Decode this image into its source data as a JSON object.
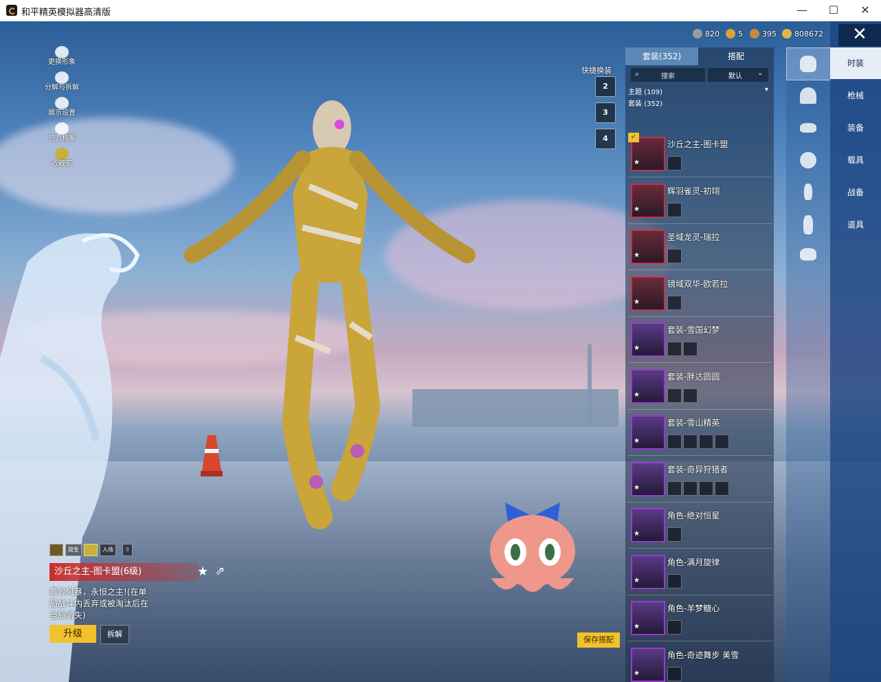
{
  "window": {
    "title": "和平精英模拟器高清版",
    "minimize": "—",
    "maximize": "☐",
    "close": "✕"
  },
  "currency": [
    {
      "value": "820",
      "color": "#9a9a9a"
    },
    {
      "value": "5",
      "color": "#d6a23b"
    },
    {
      "value": "395",
      "color": "#c88a3a"
    },
    {
      "value": "808672",
      "color": "#e0b84a"
    }
  ],
  "side_menu": [
    {
      "label": "更换形象",
      "icon": "person-icon"
    },
    {
      "label": "分解与拆解",
      "icon": "puzzle-icon"
    },
    {
      "label": "展示设置",
      "icon": "eye-icon"
    },
    {
      "label": "热力档案",
      "icon": "flame-icon"
    },
    {
      "label": "收藏家",
      "icon": "collector-icon"
    }
  ],
  "quick_change": {
    "label": "快捷换装",
    "slots": [
      "2",
      "3",
      "4"
    ]
  },
  "list": {
    "tabs": [
      "套装(352)",
      "搭配"
    ],
    "search_placeholder": "搜索",
    "sort": "默认",
    "filter": "主题 (109)",
    "section": "套装 (352)",
    "items": [
      {
        "name": "沙丘之主-图卡盟",
        "rarity": "red",
        "subs": 1,
        "selected": true
      },
      {
        "name": "辉羽雀灵-初翊",
        "rarity": "red",
        "subs": 1
      },
      {
        "name": "圣域龙灵-瑞拉",
        "rarity": "red",
        "subs": 1
      },
      {
        "name": "镜域双华-欧若拉",
        "rarity": "red",
        "subs": 1
      },
      {
        "name": "套装-雪国幻梦",
        "rarity": "purple",
        "subs": 2
      },
      {
        "name": "套装-胖达圆圆",
        "rarity": "purple",
        "subs": 2
      },
      {
        "name": "套装-雪山精英",
        "rarity": "purple",
        "subs": 4
      },
      {
        "name": "套装-奇异狩猎者",
        "rarity": "purple",
        "subs": 4
      },
      {
        "name": "角色-绝对恒星",
        "rarity": "purple",
        "subs": 1
      },
      {
        "name": "角色-满月旋律",
        "rarity": "purple",
        "subs": 1
      },
      {
        "name": "角色-羊梦糖心",
        "rarity": "purple",
        "subs": 1
      },
      {
        "name": "角色-奇迹舞步 美雪",
        "rarity": "purple",
        "subs": 1
      }
    ]
  },
  "categories": [
    "outfit-icon",
    "cap-icon",
    "goggles-icon",
    "face-icon",
    "body-icon",
    "pants-icon",
    "shoes-icon"
  ],
  "side_tabs": [
    "时装",
    "枪械",
    "装备",
    "载具",
    "战备",
    "道具"
  ],
  "info": {
    "badges": [
      "双生",
      "入场"
    ],
    "title": "沙丘之主-图卡盟(6级)",
    "description": "黄沙风暴，永恒之主!(在单局战斗内丢弃或被淘汰后在当局消失)",
    "upgrade": "升级",
    "dismantle": "拆解",
    "save": "保存搭配"
  }
}
